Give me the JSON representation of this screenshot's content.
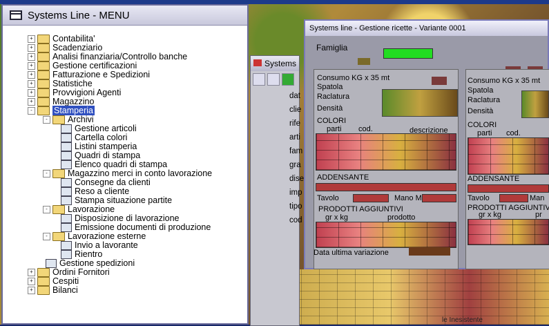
{
  "menu": {
    "title": "Systems Line - MENU",
    "items": [
      {
        "label": "Contabilita'",
        "level": 0,
        "type": "folder",
        "toggle": "+"
      },
      {
        "label": "Scadenziario",
        "level": 0,
        "type": "folder",
        "toggle": "+"
      },
      {
        "label": "Analisi finanziaria/Controllo banche",
        "level": 0,
        "type": "folder",
        "toggle": "+"
      },
      {
        "label": "Gestione certificazioni",
        "level": 0,
        "type": "folder",
        "toggle": "+"
      },
      {
        "label": "Fatturazione e Spedizioni",
        "level": 0,
        "type": "folder",
        "toggle": "+"
      },
      {
        "label": "Statistiche",
        "level": 0,
        "type": "folder",
        "toggle": "+"
      },
      {
        "label": "Provvigioni Agenti",
        "level": 0,
        "type": "folder",
        "toggle": "+"
      },
      {
        "label": "Magazzino",
        "level": 0,
        "type": "folder",
        "toggle": "+"
      },
      {
        "label": "Stamperia",
        "level": 0,
        "type": "folder",
        "toggle": "-",
        "selected": true
      },
      {
        "label": "Archivi",
        "level": 1,
        "type": "folder",
        "toggle": "-"
      },
      {
        "label": "Gestione articoli",
        "level": 2,
        "type": "doc"
      },
      {
        "label": "Cartella colori",
        "level": 2,
        "type": "doc"
      },
      {
        "label": "Listini stamperia",
        "level": 2,
        "type": "doc"
      },
      {
        "label": "Quadri di stampa",
        "level": 2,
        "type": "doc"
      },
      {
        "label": "Elenco quadri di stampa",
        "level": 2,
        "type": "doc"
      },
      {
        "label": "Magazzino merci in conto lavorazione",
        "level": 1,
        "type": "folder",
        "toggle": "-"
      },
      {
        "label": "Consegne da clienti",
        "level": 2,
        "type": "doc"
      },
      {
        "label": "Reso a cliente",
        "level": 2,
        "type": "doc"
      },
      {
        "label": "Stampa   situazione partite",
        "level": 2,
        "type": "doc"
      },
      {
        "label": "Lavorazione",
        "level": 1,
        "type": "folder",
        "toggle": "-"
      },
      {
        "label": "Disposizione di lavorazione",
        "level": 2,
        "type": "doc"
      },
      {
        "label": "Emissione documenti di produzione",
        "level": 2,
        "type": "doc"
      },
      {
        "label": "Lavorazione esterne",
        "level": 1,
        "type": "folder",
        "toggle": "-"
      },
      {
        "label": "Invio a lavorante",
        "level": 2,
        "type": "doc"
      },
      {
        "label": "Rientro",
        "level": 2,
        "type": "doc"
      },
      {
        "label": "Gestione spedizioni",
        "level": 1,
        "type": "doc"
      },
      {
        "label": "Ordini Fornitori",
        "level": 0,
        "type": "folder",
        "toggle": "+"
      },
      {
        "label": "Cespiti",
        "level": 0,
        "type": "folder",
        "toggle": "+"
      },
      {
        "label": "Bilanci",
        "level": 0,
        "type": "folder",
        "toggle": "+"
      }
    ]
  },
  "mid_window": {
    "title": "Systems",
    "labels": [
      "dat",
      "clie",
      "rife",
      "arti",
      "fam",
      "gra",
      "dise",
      "imp",
      "tipo",
      "cod"
    ]
  },
  "recipe": {
    "title": "Systems line - Gestione ricette -  Variante 0001",
    "famiglia": "Famiglia",
    "left": {
      "consumo": "Consumo KG x 35 mt",
      "spatola": "Spatola",
      "raclatura": "Raclatura",
      "densita": "Densità",
      "colori": "COLORI",
      "parti": "parti",
      "cod": "cod.",
      "descrizione": "descrizione",
      "addensante": "ADDENSANTE",
      "tavolo": "Tavolo",
      "mano": "Mano M",
      "prodotti": "PRODOTTI AGGIUNTIVI",
      "grxkg": "gr x kg",
      "prodotto": "prodotto"
    },
    "right": {
      "consumo": "Consumo KG x 35 mt",
      "spatola": "Spatola",
      "raclatura": "Raclatura",
      "densita": "Densità",
      "colori": "COLORI",
      "parti": "parti",
      "cod": "cod.",
      "addensante": "ADDENSANTE",
      "tavolo": "Tavolo",
      "mano": "Man",
      "prodotti": "PRODOTTI AGGIUNTIVI",
      "grxkg": "gr x kg",
      "prodotto": "pr"
    },
    "data_ultima": "Data ultima variazione"
  },
  "status": {
    "text": "le Inesistente"
  },
  "colors": {
    "selection": "#3050c0",
    "famiglia_field": "#22dd22"
  }
}
